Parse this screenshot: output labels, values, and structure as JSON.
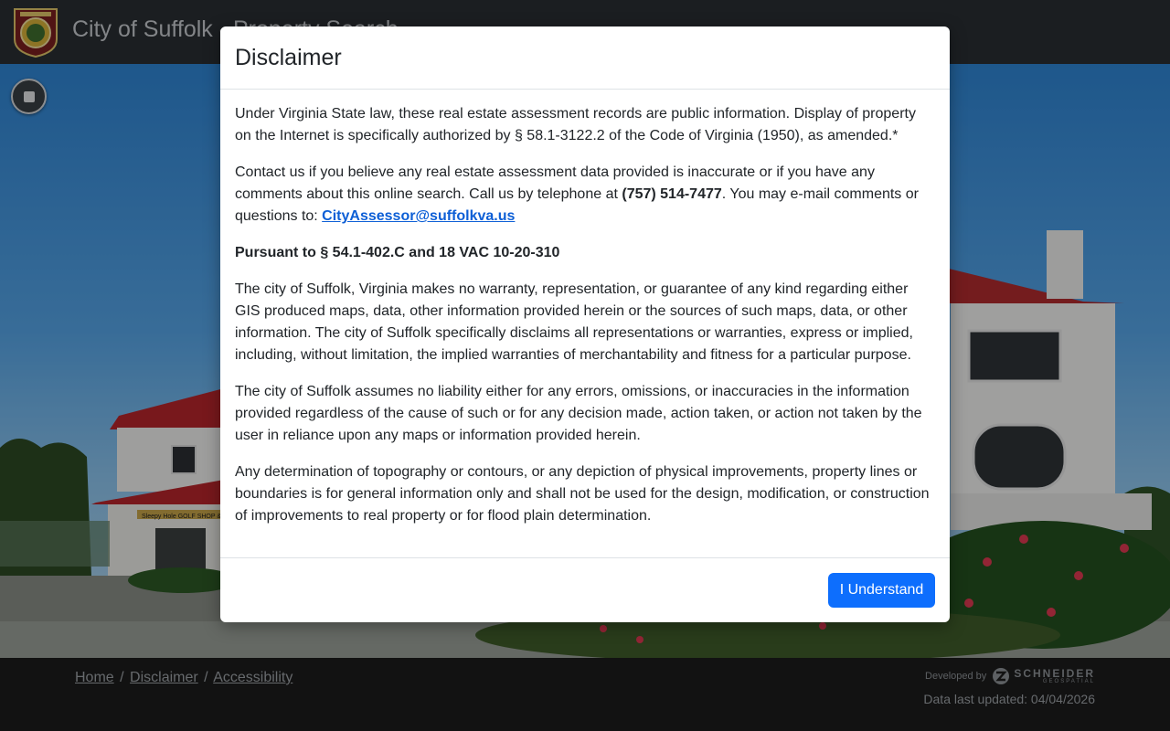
{
  "header": {
    "app_title": "City of Suffolk - Property Search",
    "logo_icon": "city-seal-icon"
  },
  "scene": {
    "stop_icon": "stop-icon",
    "sign_text": "Sleepy Hole GOLF SHOP & G"
  },
  "modal": {
    "title": "Disclaimer",
    "p1": "Under Virginia State law, these real estate assessment records are public information. Display of property on the Internet is specifically authorized by § 58.1-3122.2 of the Code of Virginia (1950), as amended.*",
    "p2_before": "Contact us if you believe any real estate assessment data provided is inaccurate or if you have any comments about this online search. Call us by telephone at ",
    "p2_phone": "(757) 514-7477",
    "p2_after": ". You may e-mail comments or questions to: ",
    "p2_email": "CityAssessor@suffolkva.us",
    "p3_heading": "Pursuant to § 54.1-402.C and 18 VAC 10-20-310",
    "p4": "The city of Suffolk, Virginia makes no warranty, representation, or guarantee of any kind regarding either GIS produced maps, data, other information provided herein or the sources of such maps, data, or other information. The city of Suffolk specifically disclaims all representations or warranties, express or implied, including, without limitation, the implied warranties of merchantability and fitness for a particular purpose.",
    "p5": "The city of Suffolk assumes no liability either for any errors, omissions, or inaccuracies in the information provided regardless of the cause of such or for any decision made, action taken, or action not taken by the user in reliance upon any maps or information provided herein.",
    "p6": "Any determination of topography or contours, or any depiction of physical improvements, property lines or boundaries is for general information only and shall not be used for the design, modification, or construction of improvements to real property or for flood plain determination.",
    "button_label": "I Understand"
  },
  "footer": {
    "links": [
      {
        "label": "Home"
      },
      {
        "label": "Disclaimer"
      },
      {
        "label": "Accessibility"
      }
    ],
    "separator": "/",
    "developed_by": "Developed by",
    "developer_name": "SCHNEIDER",
    "developer_sub": "GEOSPATIAL",
    "data_updated": "Data last updated: 04/04/2026"
  },
  "colors": {
    "primary_button": "#0d6efd",
    "link": "#0d5fd6",
    "header_bg": "#2a2f33",
    "footer_bg": "#1c1c1c"
  }
}
